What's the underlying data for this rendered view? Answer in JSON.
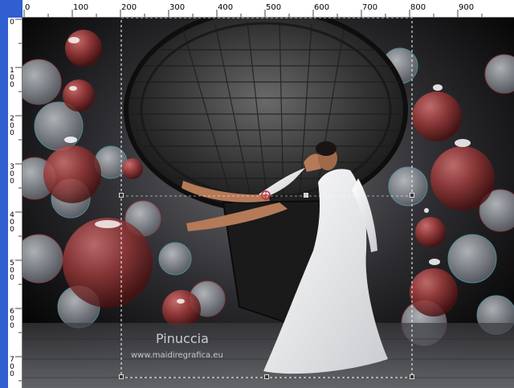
{
  "ruler_h": {
    "labels": [
      "0",
      "100",
      "200",
      "300",
      "400",
      "500",
      "600",
      "700",
      "800",
      "900"
    ]
  },
  "ruler_v": {
    "labels": [
      "0",
      "1\n0\n0",
      "2\n0\n0",
      "3\n0\n0",
      "4\n0\n0",
      "5\n0\n0",
      "6\n0\n0",
      "7\n0\n0"
    ]
  },
  "watermark": {
    "name": "Pinuccia",
    "url": "www.maidiregrafica.eu"
  },
  "colors": {
    "ruler_blue": "#2f5fd0",
    "selection": "#ffffff"
  },
  "icons": [
    "move-center-icon"
  ]
}
